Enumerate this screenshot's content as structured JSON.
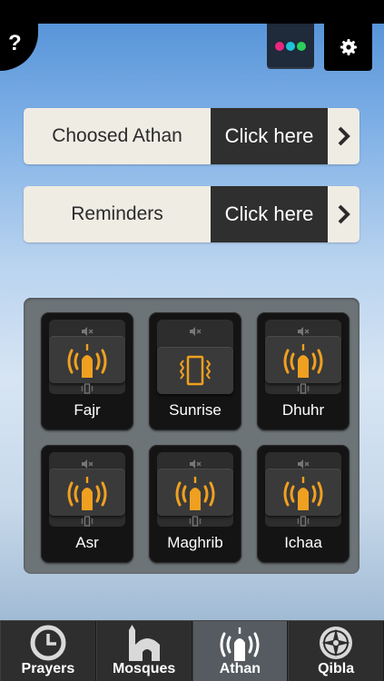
{
  "header": {
    "help_label": "?",
    "theme_colors": [
      "#e9277f",
      "#1fc2d8",
      "#2ad05a"
    ]
  },
  "rows": [
    {
      "label": "Choosed Athan",
      "action": "Click here"
    },
    {
      "label": "Reminders",
      "action": "Click here"
    }
  ],
  "prayers": [
    {
      "name": "Fajr",
      "mode": "athan"
    },
    {
      "name": "Sunrise",
      "mode": "vibrate"
    },
    {
      "name": "Dhuhr",
      "mode": "athan"
    },
    {
      "name": "Asr",
      "mode": "athan"
    },
    {
      "name": "Maghrib",
      "mode": "athan"
    },
    {
      "name": "Ichaa",
      "mode": "athan"
    }
  ],
  "tabs": [
    {
      "label": "Prayers",
      "icon": "clock-icon",
      "active": false
    },
    {
      "label": "Mosques",
      "icon": "mosque-icon",
      "active": false
    },
    {
      "label": "Athan",
      "icon": "athan-icon",
      "active": true
    },
    {
      "label": "Qibla",
      "icon": "compass-icon",
      "active": false
    }
  ],
  "colors": {
    "accent": "#f0a020",
    "tile": "#141414",
    "panel": "#6d7478"
  }
}
